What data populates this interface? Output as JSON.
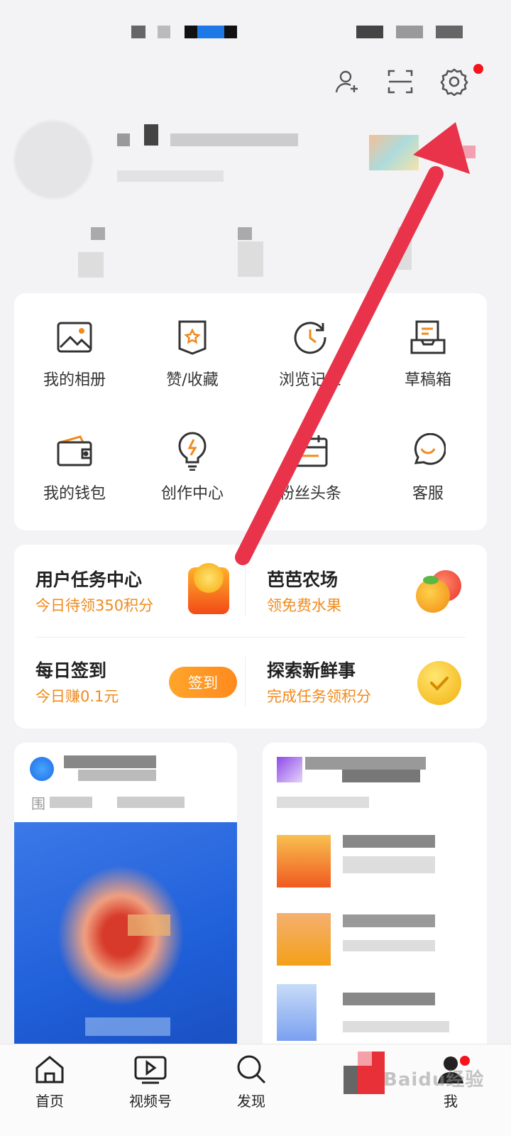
{
  "top_actions": {
    "icons": [
      "add-user-icon",
      "scan-icon",
      "gear-icon"
    ],
    "settings_badge_color": "#f5141e"
  },
  "grid": {
    "items": [
      {
        "label": "我的相册",
        "icon": "photo-album-icon"
      },
      {
        "label": "赞/收藏",
        "icon": "bookmark-star-icon"
      },
      {
        "label": "浏览记录",
        "icon": "history-clock-icon"
      },
      {
        "label": "草稿箱",
        "icon": "draft-box-icon"
      },
      {
        "label": "我的钱包",
        "icon": "wallet-icon"
      },
      {
        "label": "创作中心",
        "icon": "lightbulb-icon"
      },
      {
        "label": "粉丝头条",
        "icon": "fans-calendar-icon"
      },
      {
        "label": "客服",
        "icon": "customer-service-icon"
      }
    ]
  },
  "tasks": {
    "user_task": {
      "title": "用户任务中心",
      "subtitle": "今日待领350积分"
    },
    "farm": {
      "title": "芭芭农场",
      "subtitle": "领免费水果"
    },
    "daily_signin": {
      "title": "每日签到",
      "subtitle": "今日赚0.1元",
      "button": "签到"
    },
    "explore": {
      "title": "探索新鲜事",
      "subtitle": "完成任务领积分"
    }
  },
  "feed": {
    "left_tag": "围"
  },
  "bottom_nav": {
    "items": [
      {
        "label": "首页",
        "icon": "home-icon"
      },
      {
        "label": "视频号",
        "icon": "video-icon"
      },
      {
        "label": "发现",
        "icon": "search-icon"
      },
      {
        "label": "",
        "icon": "app-logo-icon"
      },
      {
        "label": "我",
        "icon": "profile-icon"
      }
    ]
  },
  "watermark": "Baidu经验",
  "colors": {
    "accent_orange": "#f08a1c",
    "arrow_red": "#e8334a",
    "badge_red": "#f5141e"
  }
}
